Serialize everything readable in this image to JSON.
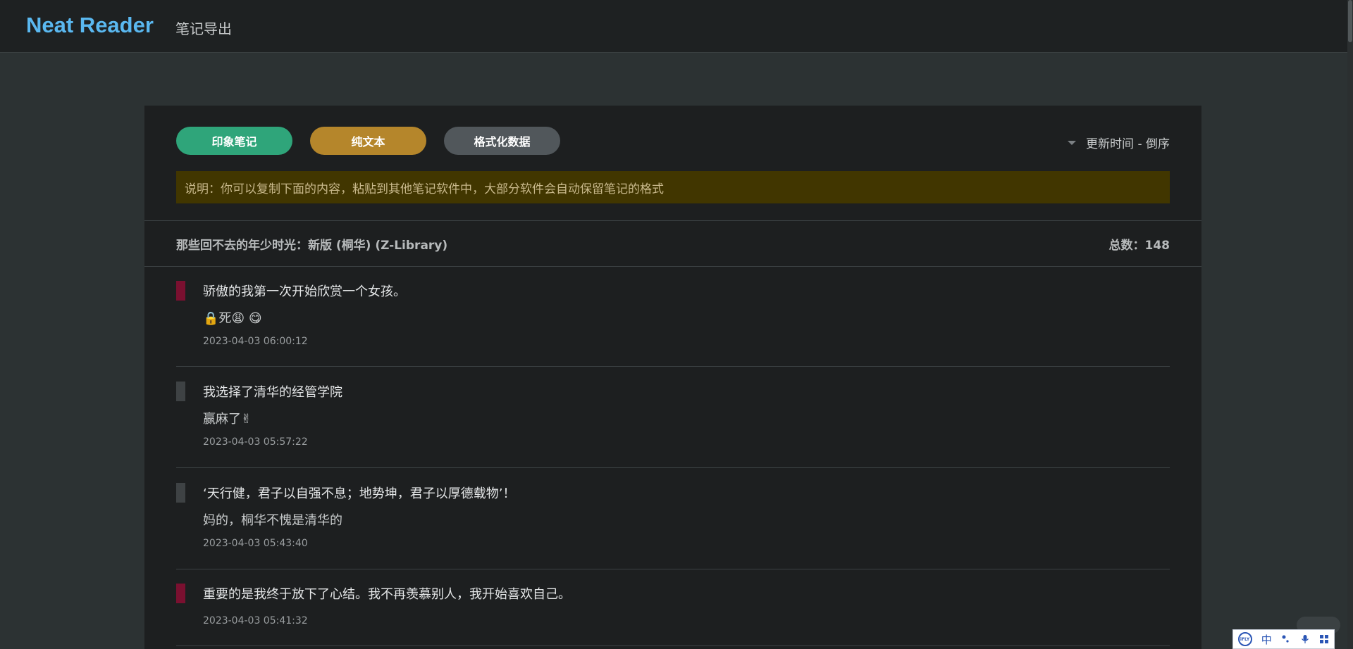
{
  "header": {
    "logo": "Neat Reader",
    "nav_label": "笔记导出"
  },
  "toolbar": {
    "buttons": [
      {
        "label": "印象笔记",
        "color": "#2fa57a"
      },
      {
        "label": "纯文本",
        "color": "#b5862b"
      },
      {
        "label": "格式化数据",
        "color": "#51575b"
      }
    ],
    "sort_label": "更新时间 - 倒序"
  },
  "notice": "说明：你可以复制下面的内容，粘贴到其他笔记软件中，大部分软件会自动保留笔记的格式",
  "book": {
    "title": "那些回不去的年少时光：新版 (桐华) (Z-Library)",
    "total": "总数：148"
  },
  "notes": [
    {
      "quote": "骄傲的我第一次开始欣赏一个女孩。",
      "comment": "🔒死😩 😋",
      "time": "2023-04-03 06:00:12",
      "highlight_color": "#7a1030"
    },
    {
      "quote": "我选择了清华的经管学院",
      "comment": "赢麻了✌",
      "time": "2023-04-03 05:57:22",
      "highlight_color": "#3e4244"
    },
    {
      "quote": "‘天行健，君子以自强不息；地势坤，君子以厚德载物’！",
      "comment": "妈的，桐华不愧是清华的",
      "time": "2023-04-03 05:43:40",
      "highlight_color": "#3e4244"
    },
    {
      "quote": "重要的是我终于放下了心结。我不再羡慕别人，我开始喜欢自己。",
      "comment": "",
      "time": "2023-04-03 05:41:32",
      "highlight_color": "#7a1030"
    }
  ],
  "ime": {
    "logo": "iFLY",
    "mode": "中"
  }
}
